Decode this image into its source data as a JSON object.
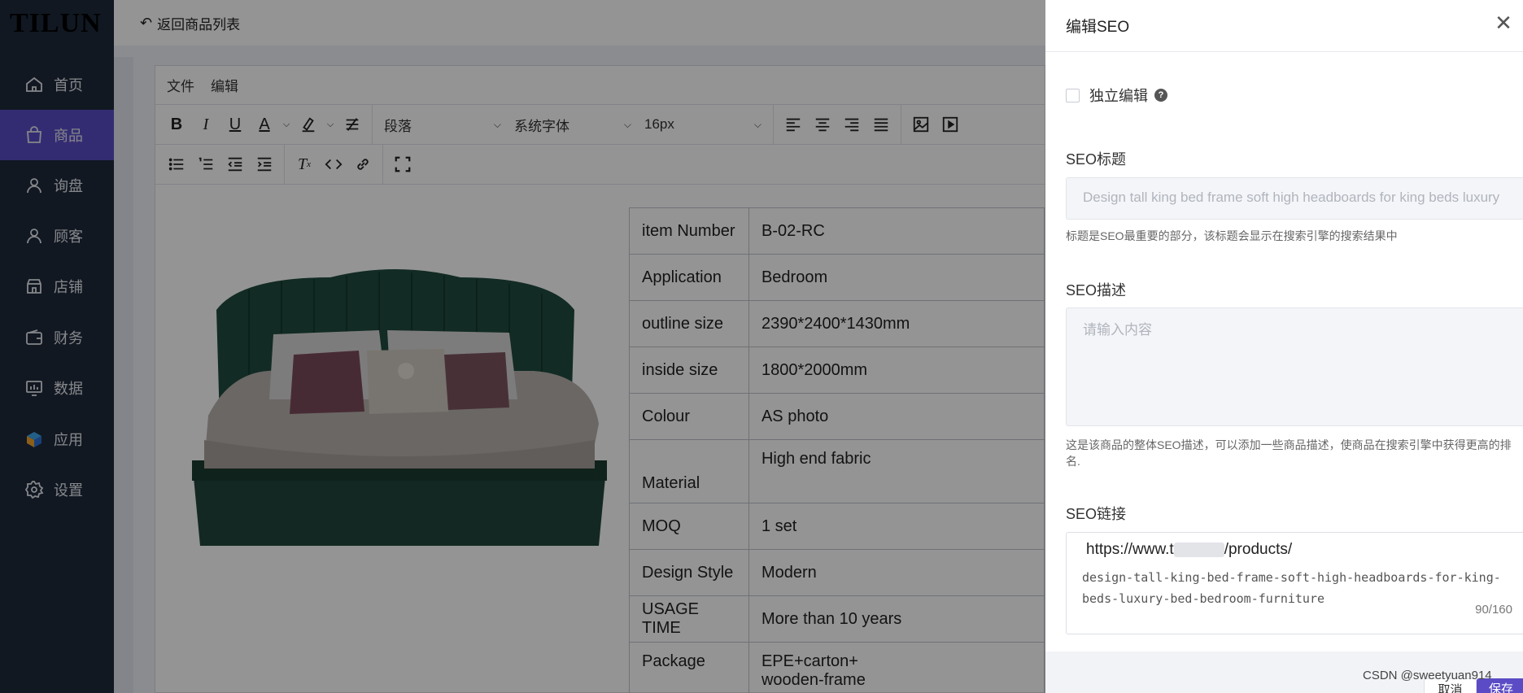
{
  "app": {
    "logo": "TILUN"
  },
  "sidebar": {
    "items": [
      {
        "label": "首页",
        "icon": "home-icon",
        "active": false
      },
      {
        "label": "商品",
        "icon": "bag-icon",
        "active": true
      },
      {
        "label": "询盘",
        "icon": "user-icon",
        "active": false
      },
      {
        "label": "顾客",
        "icon": "user-icon",
        "active": false
      },
      {
        "label": "店铺",
        "icon": "store-icon",
        "active": false
      },
      {
        "label": "财务",
        "icon": "wallet-icon",
        "active": false
      },
      {
        "label": "数据",
        "icon": "chart-icon",
        "active": false
      },
      {
        "label": "应用",
        "icon": "cube-icon",
        "active": false
      },
      {
        "label": "设置",
        "icon": "gear-icon",
        "active": false
      }
    ],
    "accent": "#5b4cc6"
  },
  "topbar": {
    "back_label": "返回商品列表"
  },
  "editor": {
    "menu": {
      "file": "文件",
      "edit": "编辑"
    },
    "block_format": "段落",
    "font_family": "系统字体",
    "font_size": "16px"
  },
  "spec_table": [
    {
      "key": "item Number",
      "value": "B-02-RC"
    },
    {
      "key": "Application",
      "value": "Bedroom"
    },
    {
      "key": "outline size",
      "value": "2390*2400*1430mm"
    },
    {
      "key": "inside size",
      "value": "1800*2000mm"
    },
    {
      "key": "Colour",
      "value": "AS photo"
    },
    {
      "key": "Material",
      "value": "High end fabric"
    },
    {
      "key": "MOQ",
      "value": "1 set"
    },
    {
      "key": "Design Style",
      "value": "Modern"
    },
    {
      "key": "USAGE TIME",
      "value": "More than 10 years"
    },
    {
      "key": "Package",
      "value": "EPE+carton+",
      "value2": "wooden-frame"
    }
  ],
  "drawer": {
    "title": "编辑SEO",
    "independent_edit_label": "独立编辑",
    "independent_edit_checked": false,
    "seo_title_label": "SEO标题",
    "seo_title_value": "Design tall king bed frame soft high headboards for king beds luxury",
    "seo_title_hint": "标题是SEO最重要的部分，该标题会显示在搜索引擎的搜索结果中",
    "seo_desc_label": "SEO描述",
    "seo_desc_placeholder": "请输入内容",
    "seo_desc_hint": "这是该商品的整体SEO描述，可以添加一些商品描述，使商品在搜索引擎中获得更高的排名.",
    "seo_link_label": "SEO链接",
    "seo_link_prefix_start": "https://www.t",
    "seo_link_prefix_end": "/products/",
    "seo_link_slug": "design-tall-king-bed-frame-soft-high-headboards-for-king-beds-luxury-bed-bedroom-furniture",
    "seo_link_counter": "90/160",
    "cancel_label": "取消",
    "save_label": "保存"
  },
  "watermark": "CSDN @sweetyuan914"
}
